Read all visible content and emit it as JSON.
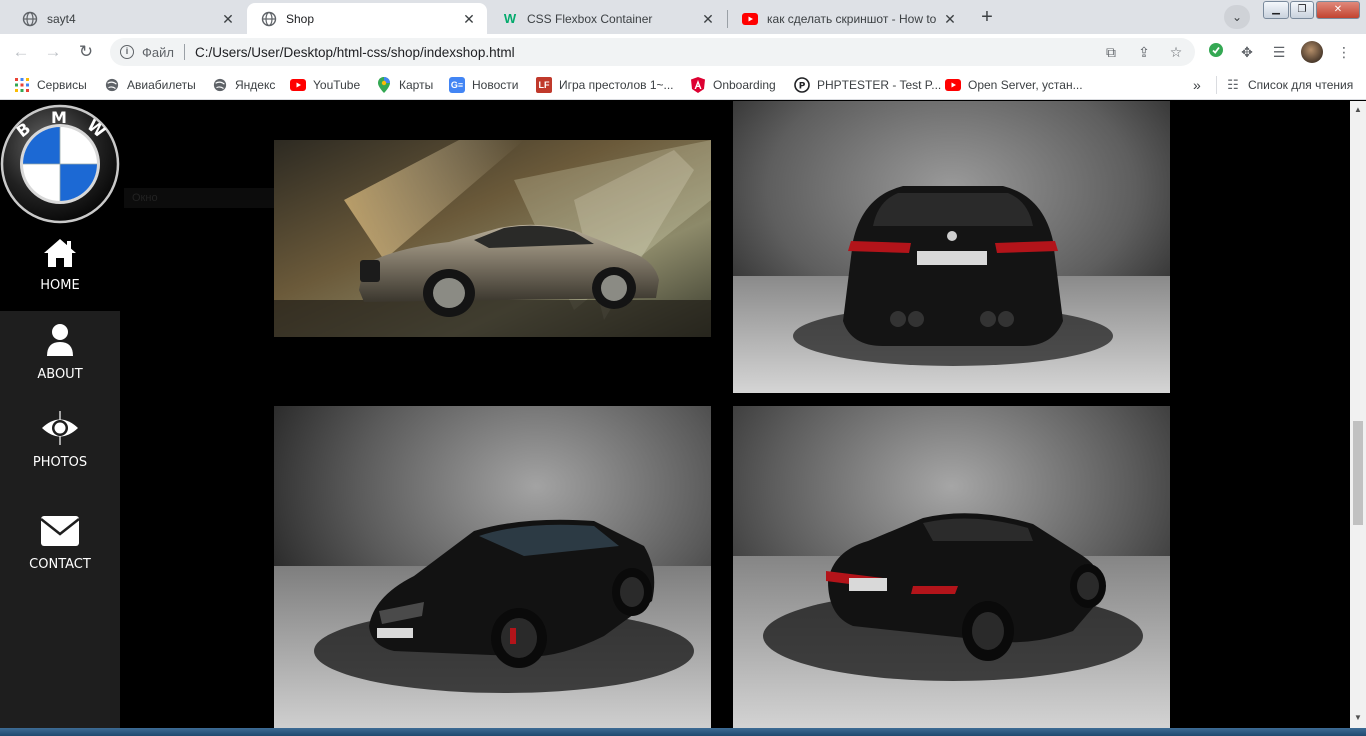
{
  "tabs": [
    {
      "title": "sayt4",
      "close": "✕",
      "favicon": "globe-icon"
    },
    {
      "title": "Shop",
      "close": "✕",
      "favicon": "globe-icon",
      "active": true
    },
    {
      "title": "CSS Flexbox Container",
      "close": "✕",
      "favicon": "w3schools-icon"
    },
    {
      "title": "как сделать скриншот - How to",
      "close": "✕",
      "favicon": "youtube-icon"
    }
  ],
  "new_tab": "+",
  "window_controls": {
    "minimize": "▁",
    "maximize": "❐",
    "close": "✕"
  },
  "address_bar": {
    "scheme_label": "Файл",
    "url": "C:/Users/User/Desktop/html-css/shop/indexshop.html"
  },
  "bookmarks": [
    {
      "label": "Сервисы",
      "icon": "apps-grid-icon"
    },
    {
      "label": "Авиабилеты",
      "icon": "globe-icon"
    },
    {
      "label": "Яндекс",
      "icon": "globe-icon"
    },
    {
      "label": "YouTube",
      "icon": "youtube-icon"
    },
    {
      "label": "Карты",
      "icon": "maps-pin-icon"
    },
    {
      "label": "Новости",
      "icon": "google-news-icon"
    },
    {
      "label": "Игра престолов 1~...",
      "icon": "lf-icon"
    },
    {
      "label": "Onboarding",
      "icon": "angular-icon"
    },
    {
      "label": "PHPTESTER - Test P...",
      "icon": "phptester-icon"
    },
    {
      "label": "Open Server, устан...",
      "icon": "youtube-icon"
    }
  ],
  "bookmarks_overflow": "»",
  "reading_list": "Список для чтения",
  "page": {
    "logo_letters": [
      "B",
      "M",
      "W"
    ],
    "nav": [
      {
        "label": "HOME",
        "icon": "home-icon"
      },
      {
        "label": "ABOUT",
        "icon": "user-icon"
      },
      {
        "label": "PHOTOS",
        "icon": "eye-icon"
      },
      {
        "label": "CONTACT",
        "icon": "envelope-icon"
      }
    ],
    "ghost_text": "Окно",
    "photos": [
      {
        "subject": "bmw-7-series-sedan-light-beams"
      },
      {
        "subject": "bmw-m4-black-rear-view"
      },
      {
        "subject": "bmw-m4-black-front-three-quarter"
      },
      {
        "subject": "bmw-m4-black-rear-three-quarter"
      }
    ]
  },
  "colors": {
    "page_bg": "#000000",
    "sidebar_bg": "#1e1e1e",
    "bmw_blue": "#1c69d4",
    "tabstrip_bg": "#dee1e6"
  }
}
